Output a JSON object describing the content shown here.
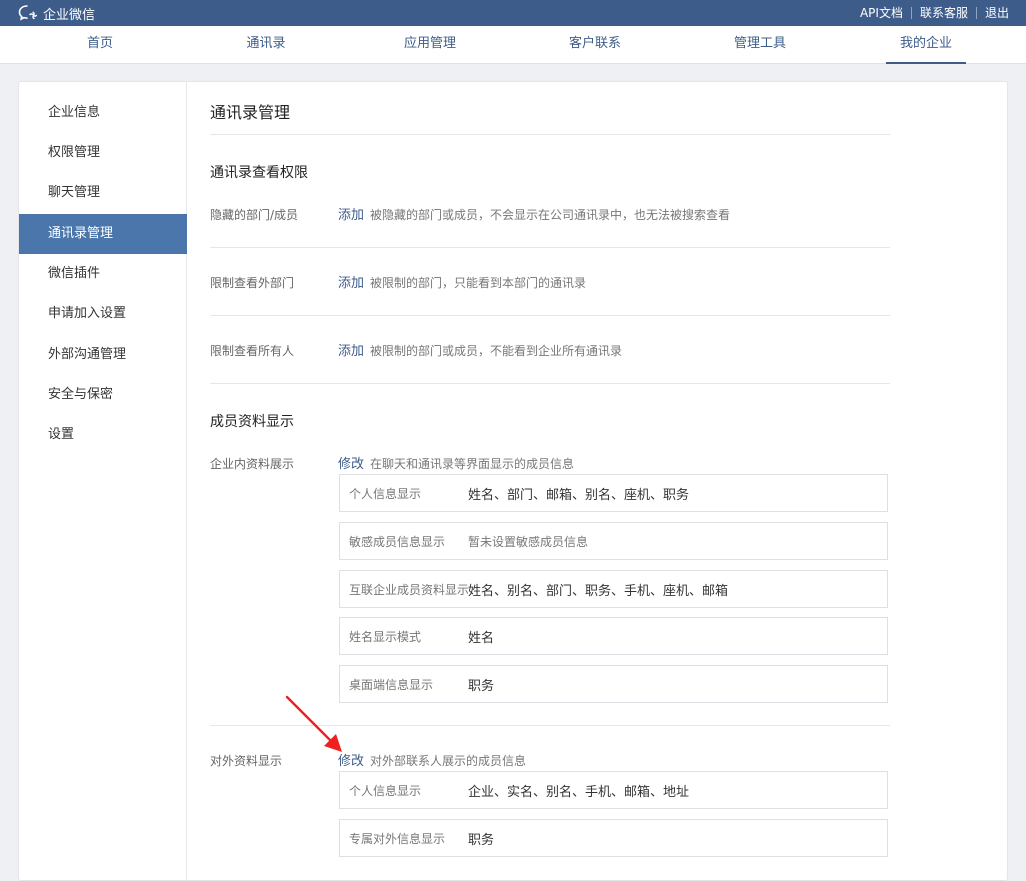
{
  "topbar": {
    "brand": "企业微信",
    "links": [
      "API文档",
      "联系客服",
      "退出"
    ]
  },
  "nav": {
    "tabs": [
      "首页",
      "通讯录",
      "应用管理",
      "客户联系",
      "管理工具",
      "我的企业"
    ],
    "active": "我的企业"
  },
  "sidebar": {
    "items": [
      "企业信息",
      "权限管理",
      "聊天管理",
      "通讯录管理",
      "微信插件",
      "申请加入设置",
      "外部沟通管理",
      "安全与保密",
      "设置"
    ],
    "active": "通讯录管理"
  },
  "main": {
    "title": "通讯录管理",
    "view_permission": {
      "title": "通讯录查看权限",
      "rows": [
        {
          "label": "隐藏的部门/成员",
          "action": "添加",
          "desc": "被隐藏的部门或成员，不会显示在公司通讯录中，也无法被搜索查看"
        },
        {
          "label": "限制查看外部门",
          "action": "添加",
          "desc": "被限制的部门，只能看到本部门的通讯录"
        },
        {
          "label": "限制查看所有人",
          "action": "添加",
          "desc": "被限制的部门或成员，不能看到企业所有通讯录"
        }
      ]
    },
    "member_display": {
      "title": "成员资料显示",
      "internal": {
        "label": "企业内资料展示",
        "action": "修改",
        "desc": "在聊天和通讯录等界面显示的成员信息",
        "items": [
          {
            "key": "个人信息显示",
            "value": "姓名、部门、邮箱、别名、座机、职务"
          },
          {
            "key": "敏感成员信息显示",
            "value": "暂未设置敏感成员信息"
          },
          {
            "key": "互联企业成员资料显示",
            "value": "姓名、别名、部门、职务、手机、座机、邮箱"
          },
          {
            "key": "姓名显示模式",
            "value": "姓名"
          },
          {
            "key": "桌面端信息显示",
            "value": "职务"
          }
        ]
      },
      "external": {
        "label": "对外资料显示",
        "action": "修改",
        "desc": "对外部联系人展示的成员信息",
        "items": [
          {
            "key": "个人信息显示",
            "value": "企业、实名、别名、手机、邮箱、地址"
          },
          {
            "key": "专属对外信息显示",
            "value": "职务"
          }
        ]
      }
    }
  },
  "colors": {
    "topbar": "#3d5c8a",
    "sidebar_active": "#4a76ab",
    "link": "#3d5c8a",
    "annotation_arrow": "#f02020"
  },
  "icons": {
    "brand": "chat-bubble-icon"
  }
}
